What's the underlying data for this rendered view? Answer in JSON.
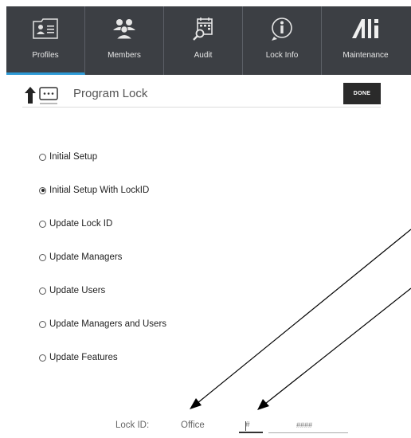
{
  "nav": {
    "tabs": [
      {
        "label": "Profiles",
        "icon": "profiles-icon",
        "active": true
      },
      {
        "label": "Members",
        "icon": "members-icon",
        "active": false
      },
      {
        "label": "Audit",
        "icon": "audit-icon",
        "active": false
      },
      {
        "label": "Lock Info",
        "icon": "info-icon",
        "active": false
      },
      {
        "label": "Maintenance",
        "icon": "maintenance-icon",
        "active": false
      }
    ]
  },
  "header": {
    "title": "Program Lock",
    "done_label": "DONE"
  },
  "options": [
    {
      "label": "Initial Setup",
      "selected": false
    },
    {
      "label": "Initial Setup With LockID",
      "selected": true
    },
    {
      "label": "Update Lock ID",
      "selected": false
    },
    {
      "label": "Update Managers",
      "selected": false
    },
    {
      "label": "Update Users",
      "selected": false
    },
    {
      "label": "Update Managers and Users",
      "selected": false
    },
    {
      "label": "Update Features",
      "selected": false
    }
  ],
  "lock_id": {
    "label": "Lock ID:",
    "value": "Office",
    "prefix_placeholder": "#",
    "number_placeholder": "####"
  },
  "colors": {
    "nav_background": "#3c3f44",
    "active_tab_underline": "#2d9ad6",
    "done_button": "#2a2a2a"
  }
}
